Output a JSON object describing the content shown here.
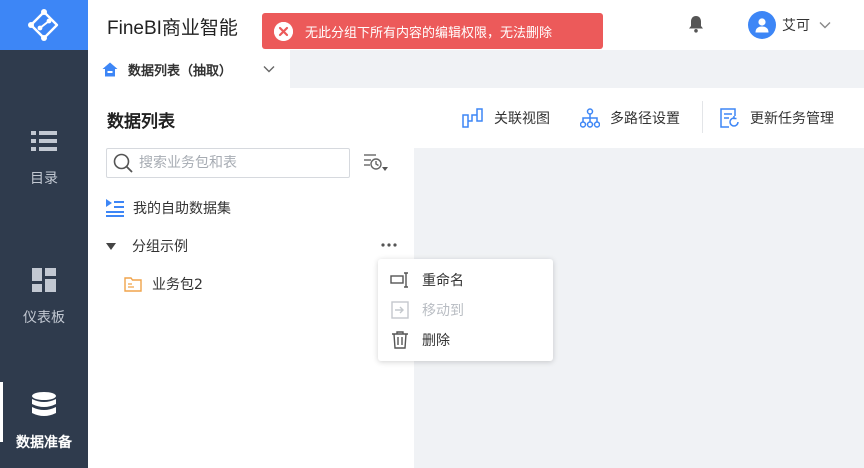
{
  "app": {
    "title": "FineBI商业智能"
  },
  "toast": {
    "message": "无此分组下所有内容的编辑权限，无法删除"
  },
  "user": {
    "name": "艾可"
  },
  "nav": {
    "items": [
      {
        "label": "目录"
      },
      {
        "label": "仪表板"
      },
      {
        "label": "数据准备"
      }
    ]
  },
  "tab": {
    "label": "数据列表（抽取）"
  },
  "panel": {
    "title": "数据列表",
    "search_placeholder": "搜索业务包和表",
    "tree": {
      "self_dataset": "我的自助数据集",
      "group": "分组示例",
      "package": "业务包2"
    }
  },
  "toolbar": {
    "relation_view": "关联视图",
    "multipath": "多路径设置",
    "update_task": "更新任务管理"
  },
  "context_menu": {
    "rename": "重命名",
    "move_to": "移动到",
    "delete": "删除"
  },
  "colors": {
    "accent": "#3d86f6",
    "rail": "#2f3b4d",
    "error": "#ec5a5a",
    "folder": "#f0a44b"
  }
}
